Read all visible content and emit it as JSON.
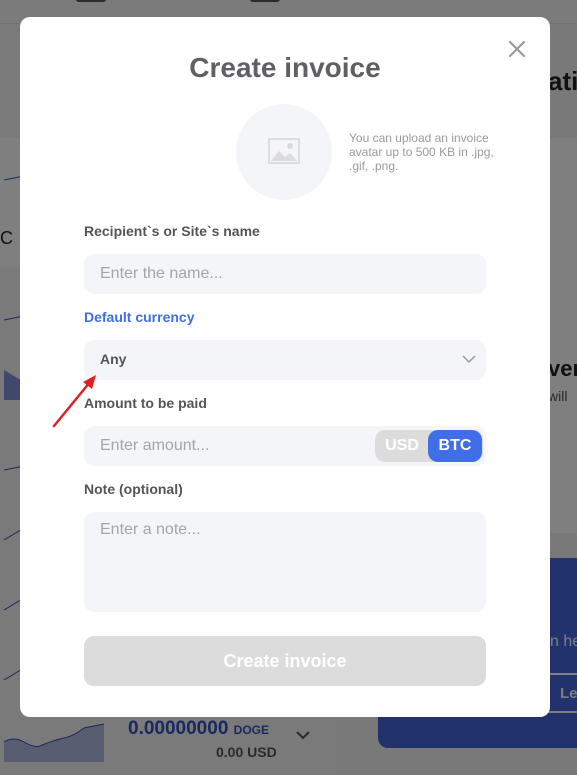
{
  "background": {
    "left_fragment": "C",
    "right_title_fragment": "ati",
    "right_heading_fragment": "ver",
    "right_sub_fragment": "will",
    "promo_text_fragment": "n he",
    "promo_button_fragment": "Le",
    "balance_amount": "0.00000000",
    "balance_currency": "DOGE",
    "balance_usd": "0.00 USD"
  },
  "modal": {
    "title": "Create invoice",
    "avatar_hint": "You can upload an invoice avatar up to 500 KB in .jpg, .gif, .png.",
    "name": {
      "label": "Recipient`s or Site`s name",
      "value": "",
      "placeholder": "Enter the name..."
    },
    "currency": {
      "label": "Default currency",
      "selected": "Any"
    },
    "amount": {
      "label": "Amount to be paid",
      "value": "",
      "placeholder": "Enter amount...",
      "units": [
        "USD",
        "BTC"
      ],
      "active_unit": "BTC"
    },
    "note": {
      "label": "Note (optional)",
      "value": "",
      "placeholder": "Enter a note..."
    },
    "submit_label": "Create invoice"
  },
  "colors": {
    "accent": "#3f6ee8",
    "disabled": "#dcdcdc",
    "field_bg": "#f4f5f9",
    "annotation_arrow": "#e02020"
  }
}
